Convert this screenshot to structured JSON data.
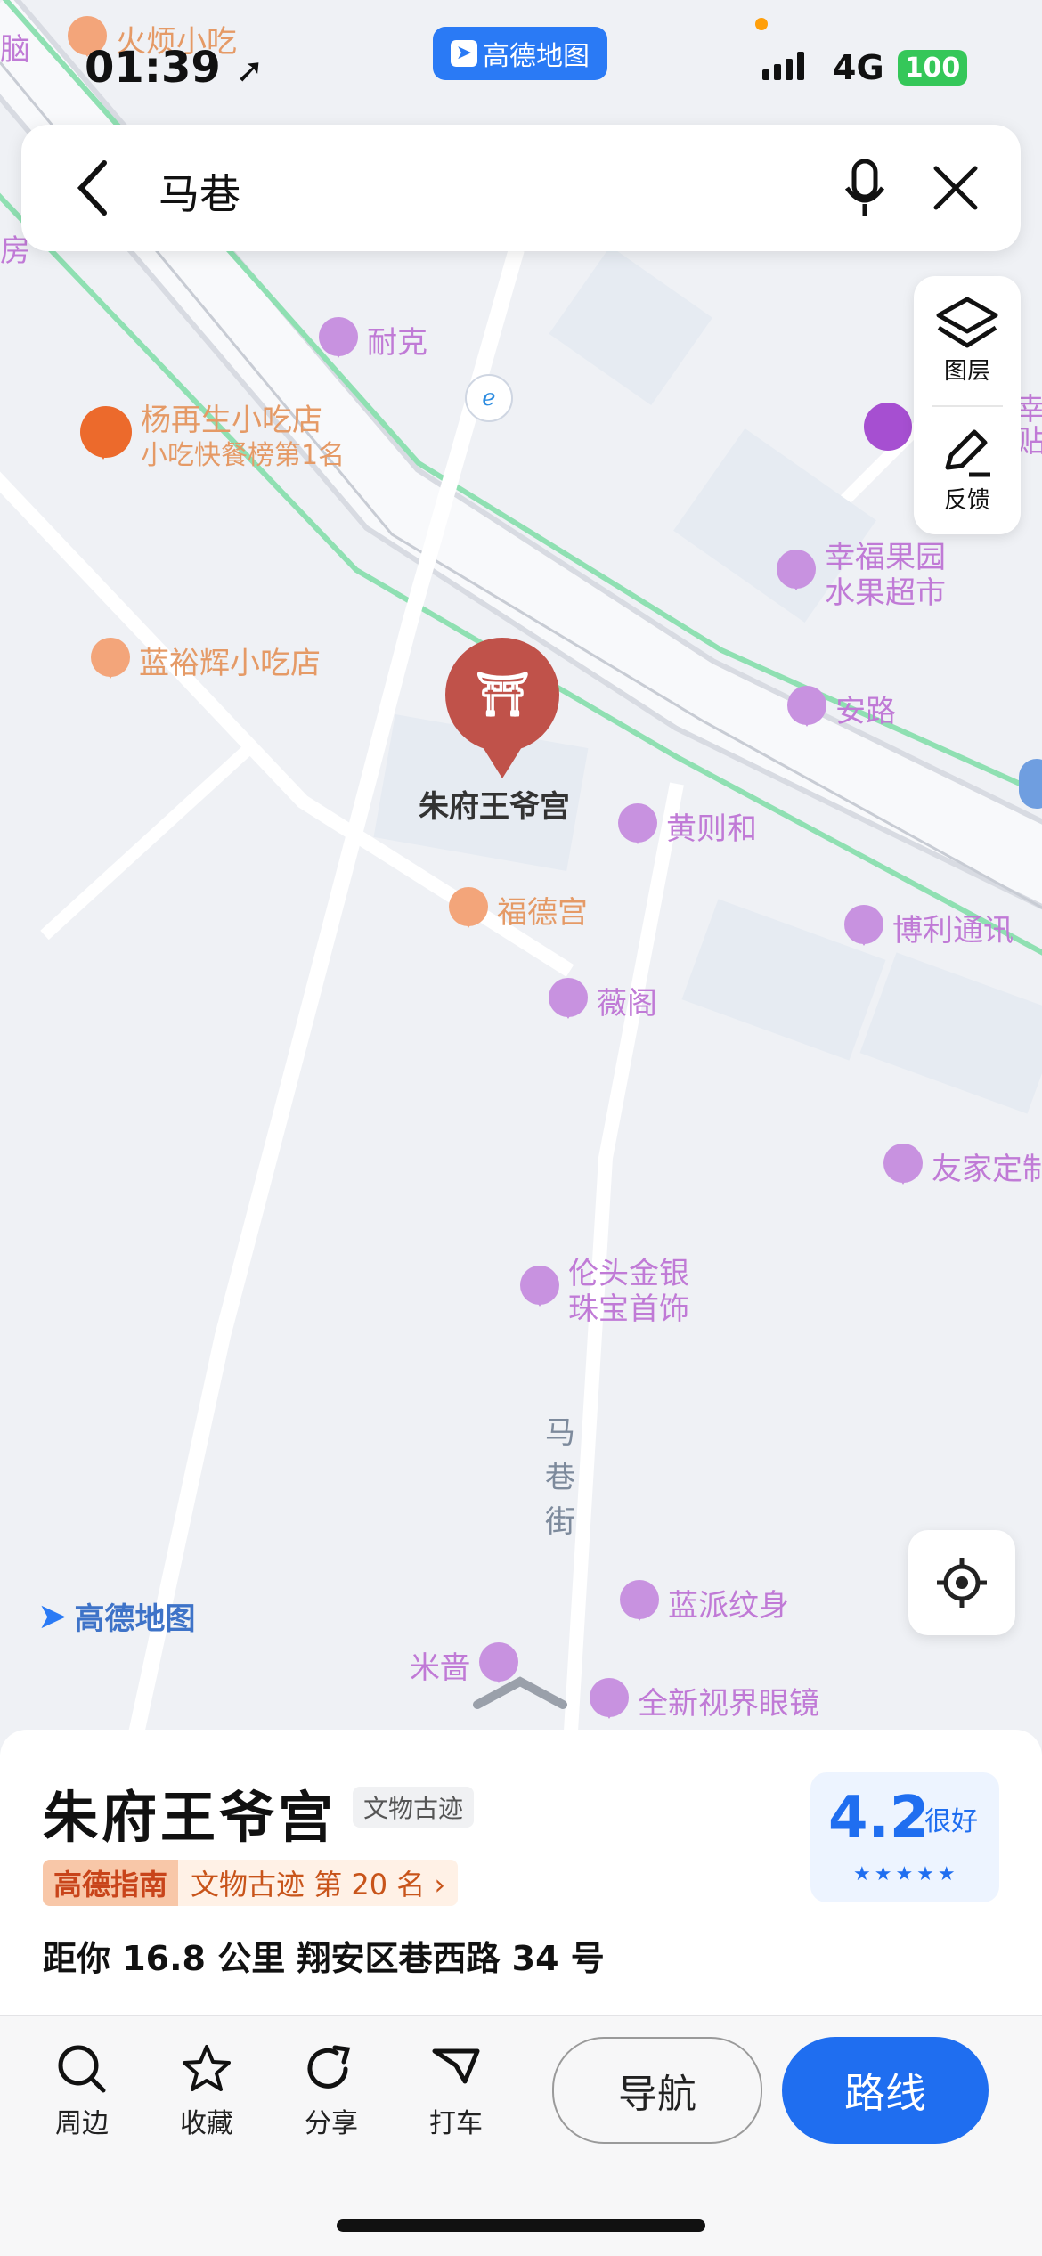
{
  "status_bar": {
    "time": "01:39",
    "app_badge": "高德地图",
    "network": "4G",
    "battery": "100"
  },
  "search": {
    "query": "马巷"
  },
  "side_panel": {
    "layers_label": "图层",
    "feedback_label": "反馈"
  },
  "map": {
    "watermark": "高德地图",
    "selected_poi": "朱府王爷宫",
    "street_label": "马巷街",
    "street_chars": [
      "马",
      "巷",
      "街"
    ],
    "pois": {
      "top_left_1": "火烦小吃",
      "top_left_2": "脑",
      "left_edge": "房",
      "naike": "耐克",
      "yzs": "杨再生小吃店",
      "yzs_sub": "小吃快餐榜第1名",
      "lyh": "蓝裕辉小吃店",
      "xfgy_1": "幸福果园",
      "xfgy_2": "水果超市",
      "anlu": "安路",
      "hzh": "黄则和",
      "fdg": "福德宫",
      "blt": "博利通讯",
      "wg": "薇阁",
      "yjd": "友家定制",
      "ltjy_1": "伦头金银",
      "ltjy_2": "珠宝首饰",
      "lpws": "蓝派纹身",
      "mq": "米啬",
      "qxsj": "全新视界眼镜",
      "right_edge_1": "幸悦",
      "right_edge_2": "贴"
    }
  },
  "detail": {
    "name": "朱府王爷宫",
    "category_tag": "文物古迹",
    "rank_logo": "高德指南",
    "rank_text": "文物古迹  第 20 名 ›",
    "distance_address": "距你 16.8 公里   翔安区巷西路 34 号",
    "rating": "4.2",
    "rating_word": "很好",
    "stars": "★★★★★"
  },
  "actions": {
    "nearby": "周边",
    "favorite": "收藏",
    "share": "分享",
    "taxi": "打车",
    "navigate": "导航",
    "route": "路线"
  },
  "colors": {
    "accent": "#1f6ef0",
    "poi_purple": "#c07ad6",
    "poi_orange": "#e59a66",
    "road_green": "#8fe0b2",
    "selected_pin": "#c0524a"
  }
}
